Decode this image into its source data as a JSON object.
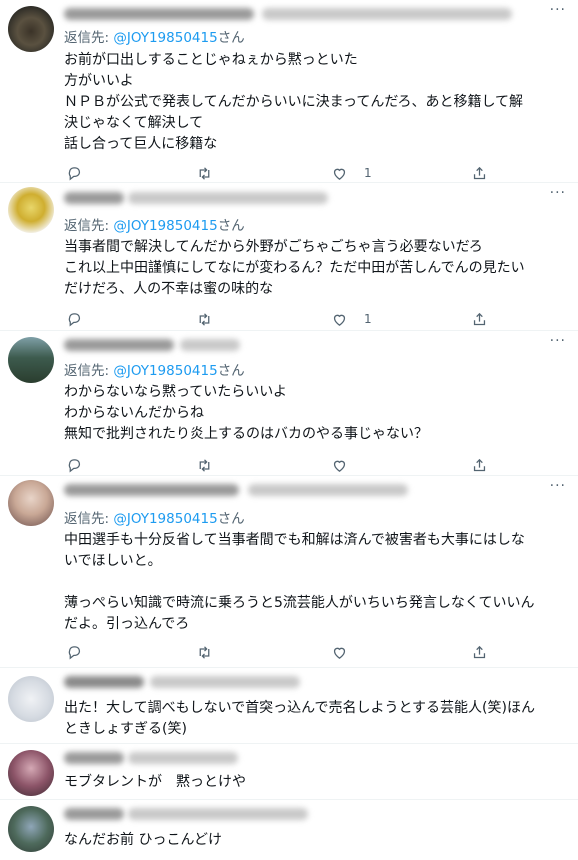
{
  "reply_prefix": "返信先: ",
  "reply_suffix": "さん",
  "more_label": "···",
  "tweets": [
    {
      "handle": "@JOY19850415",
      "text": "お前が口出しすることじゃねぇから黙っといた\n方がいいよ\nＮＰＢが公式で発表してんだからいいに決まってんだろ、あと移籍して解\n決じゃなくて解決して\n話し合って巨人に移籍な",
      "like_count": "1"
    },
    {
      "handle": "@JOY19850415",
      "text": "当事者間で解決してんだから外野がごちゃごちゃ言う必要ないだろ\nこれ以上中田謹慎にしてなにが変わるん？ただ中田が苦しんでんの見たい\nだけだろ、人の不幸は蜜の味的な",
      "like_count": "1"
    },
    {
      "handle": "@JOY19850415",
      "text": "わからないなら黙っていたらいいよ\nわからないんだからね\n無知で批判されたり炎上するのはバカのやる事じゃない？",
      "like_count": ""
    },
    {
      "handle": "@JOY19850415",
      "text": "中田選手も十分反省して当事者間でも和解は済んで被害者も大事にはしな\nいでほしいと。\n\n薄っぺらい知識で時流に乗ろうと5流芸能人がいちいち発言しなくていいん\nだよ。引っ込んでろ",
      "like_count": ""
    },
    {
      "text": "出た！大して調べもしないで首突っ込んで売名しようとする芸能人(笑)ほん\nときしょすぎる(笑)"
    },
    {
      "text": "モブタレントが　黙っとけや"
    },
    {
      "text": "なんだお前 ひっこんどけ"
    }
  ]
}
